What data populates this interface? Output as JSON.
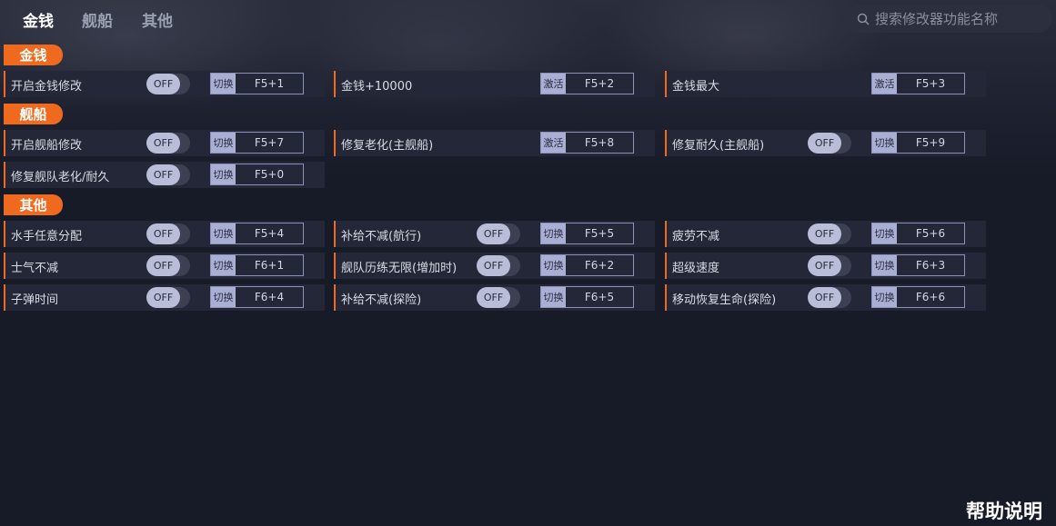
{
  "nav": {
    "tabs": [
      "金钱",
      "舰船",
      "其他"
    ],
    "active": 0
  },
  "search": {
    "placeholder": "搜索修改器功能名称"
  },
  "colors": {
    "accent": "#ef6a1e",
    "background": "#171a27",
    "row": "#232737"
  },
  "toggle_state": "OFF",
  "sections": [
    {
      "title": "金钱"
    },
    {
      "title": "舰船"
    },
    {
      "title": "其他"
    }
  ],
  "items": [
    {
      "label": "开启金钱修改",
      "toggle": true,
      "mode": "切换",
      "key": "F5+1"
    },
    {
      "label": "金钱+10000",
      "toggle": false,
      "mode": "激活",
      "key": "F5+2"
    },
    {
      "label": "金钱最大",
      "toggle": false,
      "mode": "激活",
      "key": "F5+3"
    },
    {
      "label": "开启舰船修改",
      "toggle": true,
      "mode": "切换",
      "key": "F5+7"
    },
    {
      "label": "修复老化(主舰船)",
      "toggle": false,
      "mode": "激活",
      "key": "F5+8"
    },
    {
      "label": "修复耐久(主舰船)",
      "toggle": true,
      "mode": "切换",
      "key": "F5+9"
    },
    {
      "label": "修复舰队老化/耐久",
      "toggle": true,
      "mode": "切换",
      "key": "F5+0"
    },
    {
      "label": "水手任意分配",
      "toggle": true,
      "mode": "切换",
      "key": "F5+4"
    },
    {
      "label": "补给不减(航行)",
      "toggle": true,
      "mode": "切换",
      "key": "F5+5"
    },
    {
      "label": "疲劳不减",
      "toggle": true,
      "mode": "切换",
      "key": "F5+6"
    },
    {
      "label": "士气不减",
      "toggle": true,
      "mode": "切换",
      "key": "F6+1"
    },
    {
      "label": "舰队历练无限(增加时)",
      "toggle": true,
      "mode": "切换",
      "key": "F6+2"
    },
    {
      "label": "超级速度",
      "toggle": true,
      "mode": "切换",
      "key": "F6+3"
    },
    {
      "label": "子弹时间",
      "toggle": true,
      "mode": "切换",
      "key": "F6+4"
    },
    {
      "label": "补给不减(探险)",
      "toggle": true,
      "mode": "切换",
      "key": "F6+5"
    },
    {
      "label": "移动恢复生命(探险)",
      "toggle": true,
      "mode": "切换",
      "key": "F6+6"
    }
  ],
  "help_label": "帮助说明"
}
